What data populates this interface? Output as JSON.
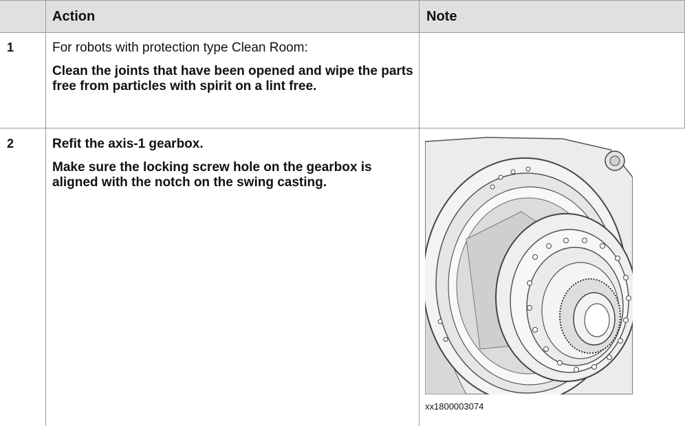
{
  "table": {
    "headers": {
      "action": "Action",
      "note": "Note"
    },
    "rows": [
      {
        "number": "1",
        "lines": [
          "For robots with protection type Clean Room:",
          "Clean the joints that have been opened and wipe the parts free from particles with spirit on a lint free."
        ]
      },
      {
        "number": "2",
        "lines": [
          "Refit the axis-1 gearbox.",
          "Make sure the locking screw hole on the gearbox is aligned with the notch on the swing casting."
        ],
        "figure_caption": "xx1800003074"
      }
    ]
  },
  "figure": {
    "icon": "gearbox-illustration",
    "stroke_color": "#444444",
    "fill_color": "#e9e9e9"
  }
}
